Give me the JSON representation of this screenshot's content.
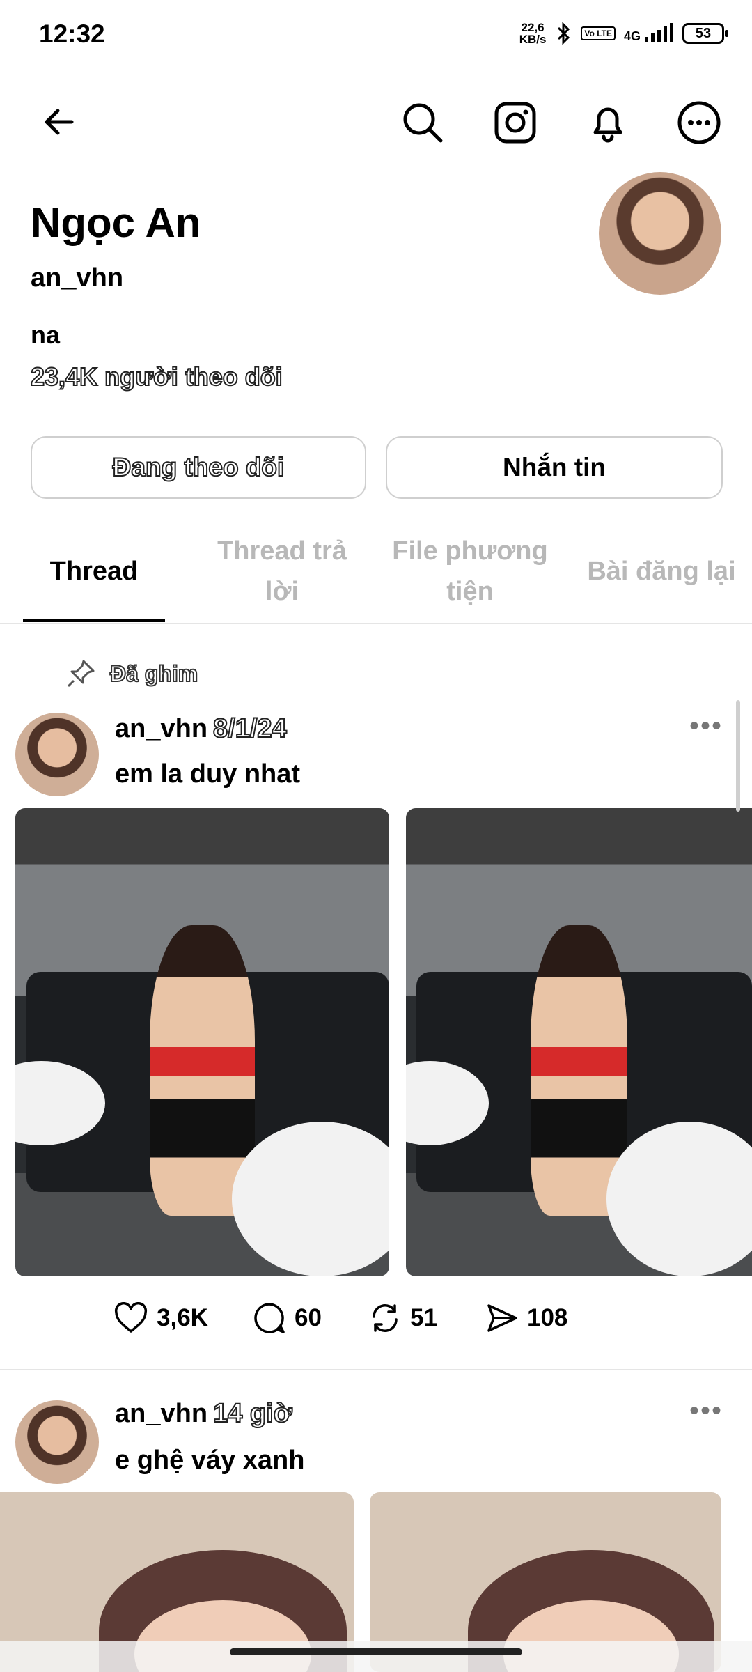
{
  "status_bar": {
    "time": "12:32",
    "net_speed_value": "22,6",
    "net_speed_unit": "KB/s",
    "volte": "Vo LTE",
    "network": "4G",
    "battery": "53"
  },
  "profile": {
    "name": "Ngọc An",
    "handle": "an_vhn",
    "bio": "na",
    "followers": "23,4K người theo dõi",
    "buttons": {
      "following": "Đang theo dõi",
      "message": "Nhắn tin"
    }
  },
  "tabs": [
    {
      "label": "Thread"
    },
    {
      "label": "Thread trả lời"
    },
    {
      "label": "File phương tiện"
    },
    {
      "label": "Bài đăng lại"
    }
  ],
  "posts": [
    {
      "pinned_label": "Đã ghim",
      "user": "an_vhn",
      "time": "8/1/24",
      "text": "em la duy nhat",
      "likes": "3,6K",
      "comments": "60",
      "reposts": "51",
      "shares": "108"
    },
    {
      "user": "an_vhn",
      "time": "14 giờ",
      "text": "e ghệ váy xanh"
    }
  ],
  "icons": {
    "back": "back-arrow-icon",
    "search": "search-icon",
    "instagram": "instagram-icon",
    "notifications": "bell-icon",
    "more": "more-options-icon"
  }
}
